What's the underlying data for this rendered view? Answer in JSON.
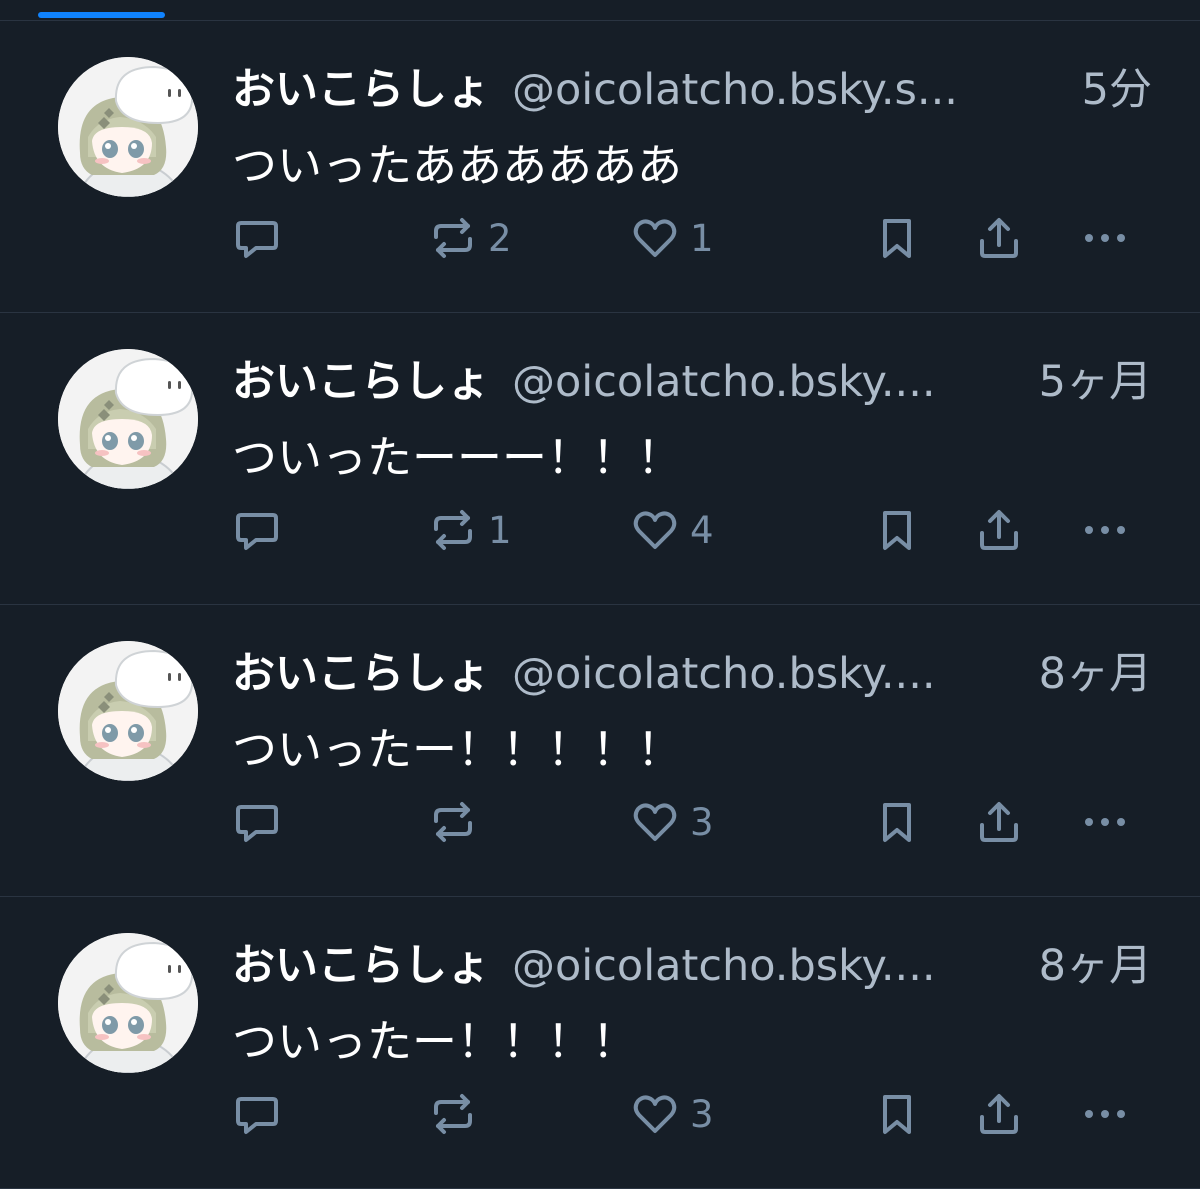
{
  "theme": {
    "background": "#161e27",
    "accent": "#1083fe",
    "muted_text": "#aebbc9",
    "icon_color": "#788ea5",
    "divider": "#2a3441"
  },
  "tabs": {
    "active_indicator": "active-tab"
  },
  "posts": [
    {
      "avatar": "user-avatar",
      "display_name": "おいこらしょ",
      "handle": "@oicolatcho.bsky.s...",
      "timestamp": "5分",
      "text": "ついったああああああ",
      "reply_count": "",
      "repost_count": "2",
      "like_count": "1"
    },
    {
      "avatar": "user-avatar",
      "display_name": "おいこらしょ",
      "handle": "@oicolatcho.bsky....",
      "timestamp": "5ヶ月",
      "text": "ついったーーー！！！",
      "reply_count": "",
      "repost_count": "1",
      "like_count": "4"
    },
    {
      "avatar": "user-avatar",
      "display_name": "おいこらしょ",
      "handle": "@oicolatcho.bsky....",
      "timestamp": "8ヶ月",
      "text": "ついったー！！！！！",
      "reply_count": "",
      "repost_count": "",
      "like_count": "3"
    },
    {
      "avatar": "user-avatar",
      "display_name": "おいこらしょ",
      "handle": "@oicolatcho.bsky....",
      "timestamp": "8ヶ月",
      "text": "ついったー！！！！",
      "reply_count": "",
      "repost_count": "",
      "like_count": "3"
    }
  ],
  "icons": {
    "reply": "reply-icon",
    "repost": "repost-icon",
    "like": "heart-icon",
    "bookmark": "bookmark-icon",
    "share": "share-icon",
    "more": "more-icon"
  }
}
